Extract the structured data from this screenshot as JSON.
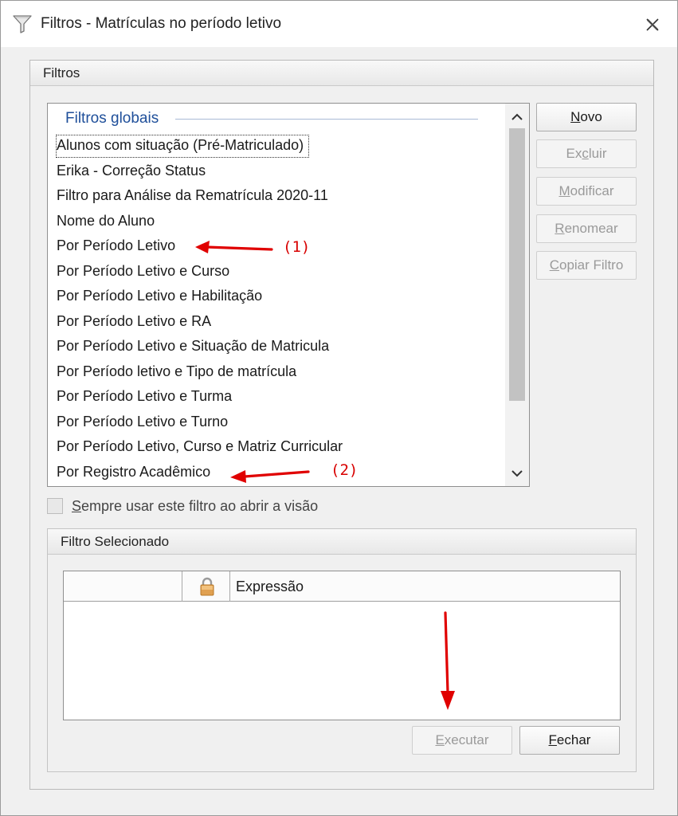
{
  "window": {
    "title": "Filtros - Matrículas no período letivo"
  },
  "filters_group": {
    "header": "Filtros",
    "list": {
      "group_title": "Filtros globais",
      "items": [
        "Alunos com situação (Pré-Matriculado)",
        "Erika - Correção Status",
        "Filtro para Análise da Rematrícula 2020-11",
        "Nome do Aluno",
        "Por Período Letivo",
        "Por Período Letivo e Curso",
        "Por Período Letivo e Habilitação",
        "Por Período Letivo e RA",
        "Por Período Letivo e Situação de Matricula",
        "Por Período letivo e Tipo de matrícula",
        "Por Período Letivo e Turma",
        "Por Período Letivo e Turno",
        "Por Período Letivo, Curso e Matriz Curricular",
        "Por Registro Acadêmico"
      ],
      "focused_index": 0
    },
    "buttons": {
      "novo": {
        "pre": "",
        "key": "N",
        "post": "ovo",
        "enabled": true
      },
      "excluir": {
        "pre": "Ex",
        "key": "c",
        "post": "luir",
        "enabled": false
      },
      "modificar": {
        "pre": "",
        "key": "M",
        "post": "odificar",
        "enabled": false
      },
      "renomear": {
        "pre": "",
        "key": "R",
        "post": "enomear",
        "enabled": false
      },
      "copiar": {
        "pre": "",
        "key": "C",
        "post": "opiar Filtro",
        "enabled": false
      }
    },
    "checkbox": {
      "pre": "",
      "key": "S",
      "post": "empre usar este filtro ao abrir a visão",
      "checked": false
    }
  },
  "selected_group": {
    "header": "Filtro Selecionado",
    "grid": {
      "columns": [
        "",
        "lock-icon",
        "Expressão"
      ],
      "expression_header": "Expressão",
      "rows": []
    },
    "buttons": {
      "executar": {
        "pre": "",
        "key": "E",
        "post": "xecutar",
        "enabled": false
      },
      "fechar": {
        "pre": "",
        "key": "F",
        "post": "echar",
        "enabled": true
      }
    }
  },
  "annotations": {
    "label_1": "(1)",
    "label_2": "(2)",
    "color": "#d80000"
  },
  "colors": {
    "group_title": "#1f4f9a",
    "window_bg": "#f0f0f0"
  }
}
